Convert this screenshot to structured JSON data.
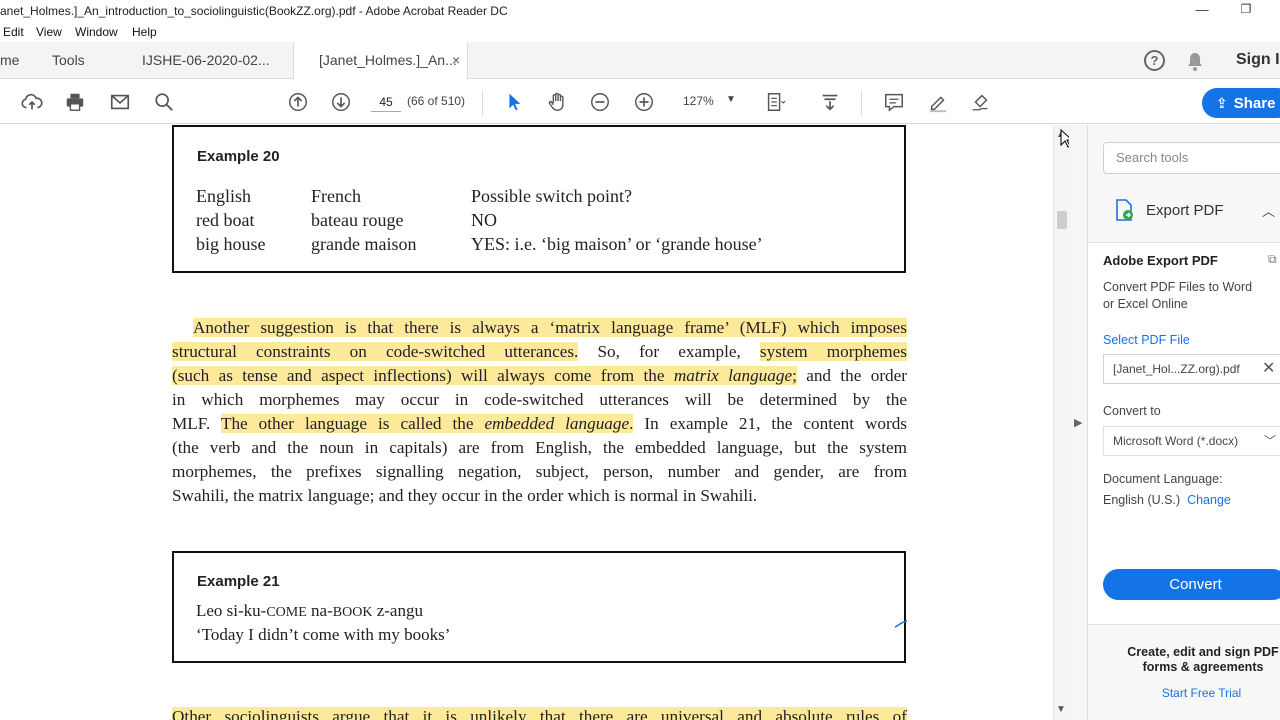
{
  "window": {
    "title": "anet_Holmes.]_An_introduction_to_sociolinguistic(BookZZ.org).pdf - Adobe Acrobat Reader DC",
    "minimize": "—",
    "restore": "❐"
  },
  "menu": [
    "Edit",
    "View",
    "Window",
    "Help"
  ],
  "tabs": {
    "home": "me",
    "tools": "Tools",
    "doc1": "IJSHE-06-2020-02...",
    "doc2": "[Janet_Holmes.]_An...",
    "close": "×",
    "signin": "Sign I"
  },
  "toolbar": {
    "page": "45",
    "page_count": "(66 of 510)",
    "zoom": "127%",
    "share": "Share"
  },
  "document": {
    "example20": {
      "label": "Example 20",
      "headers": [
        "English",
        "French",
        "Possible switch point?"
      ],
      "rows": [
        [
          "red boat",
          "bateau rouge",
          "NO"
        ],
        [
          "big house",
          "grande maison",
          "YES: i.e. ‘big maison’ or ‘grande house’"
        ]
      ]
    },
    "para1": {
      "l1a": "Another suggestion is that there is always a ‘matrix language frame’ (MLF) which imposes",
      "l2a": "structural constraints on code-switched utterances.",
      "l2b": " So, for example, ",
      "l2c": "system morphemes",
      "l3a": "(such as tense and aspect inflections) will always come from the ",
      "l3b": "matrix language",
      "l3c": ";",
      "l3d": " and the order",
      "l4": "in which morphemes may occur in code-switched utterances will be determined by the",
      "l5a": "MLF. ",
      "l5b": "The other language is called the ",
      "l5c": "embedded language",
      "l5d": ".",
      "l5e": " In example 21, the content words",
      "l6": "(the verb and the noun in capitals) are from English, the embedded language, but the system",
      "l7": "morphemes, the prefixes signalling negation, subject, person, number and gender, are from",
      "l8": "Swahili, the matrix language; and they occur in the order which is normal in Swahili."
    },
    "example21": {
      "label": "Example 21",
      "line1a": "Leo si-ku-",
      "line1b": "COME",
      "line1c": " na-",
      "line1d": "BOOK",
      "line1e": " z-angu",
      "line2": "‘Today I didn’t come with my books’"
    },
    "para2": "Other sociolinguists argue that it is unlikely that there are universal and absolute rules of"
  },
  "right_panel": {
    "search_placeholder": "Search tools",
    "export_title": "Export PDF",
    "heading": "Adobe Export PDF",
    "desc": "Convert PDF Files to Word or Excel Online",
    "select_label": "Select PDF File",
    "file_name": "[Janet_Hol...ZZ.org).pdf",
    "convert_to_label": "Convert to",
    "convert_to_value": "Microsoft Word (*.docx)",
    "doc_lang_label": "Document Language:",
    "doc_lang_value": "English (U.S.)",
    "change": "Change",
    "convert_button": "Convert",
    "promo": "Create, edit and sign PDF forms & agreements",
    "trial": "Start Free Trial"
  },
  "colors": {
    "accent": "#1473e6",
    "highlight": "#fde99a"
  }
}
